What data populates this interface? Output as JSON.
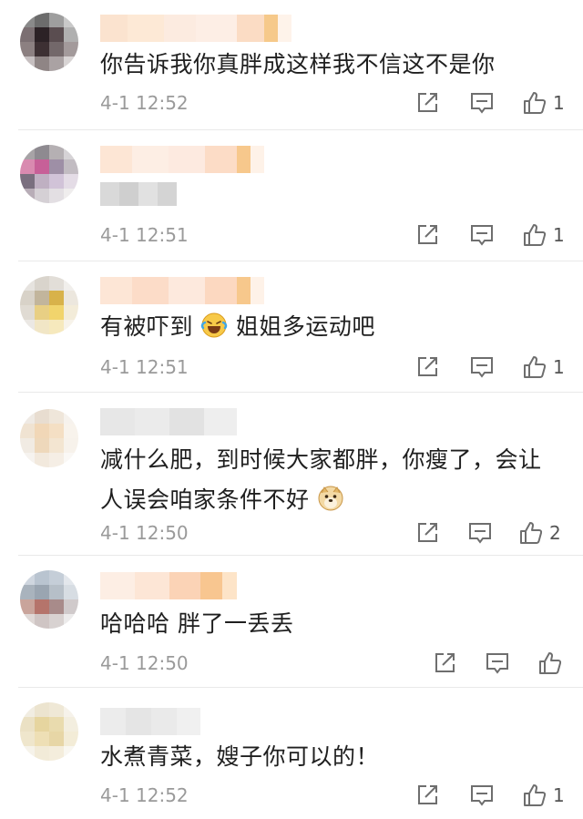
{
  "comments": [
    {
      "text": "你告诉我你真胖成这样我不信这不是你",
      "time": "4-1 12:52",
      "likes": "1"
    },
    {
      "text": "",
      "time": "4-1 12:51",
      "likes": "1"
    },
    {
      "text_before": "有被吓到",
      "text_after": "姐姐多运动吧",
      "emoji": "laugh-cry-emoji",
      "time": "4-1 12:51",
      "likes": "1"
    },
    {
      "text_line1": "减什么肥，到时候大家都胖，你瘦了，会让",
      "text_line2": "人误会咱家条件不好",
      "emoji": "doge-emoji",
      "time": "4-1 12:50",
      "likes": "2"
    },
    {
      "text": "哈哈哈 胖了一丢丢",
      "time": "4-1 12:50",
      "likes": ""
    },
    {
      "text": "水煮青菜，嫂子你可以的！",
      "time": "4-1 12:52",
      "likes": "1"
    }
  ],
  "icons": {
    "share": "share-icon",
    "reply": "comment-icon",
    "like": "thumbs-up-icon"
  },
  "colors": {
    "time": "#9a9a9a",
    "divider": "#e9e9e9",
    "icon": "#6e6e6e"
  }
}
